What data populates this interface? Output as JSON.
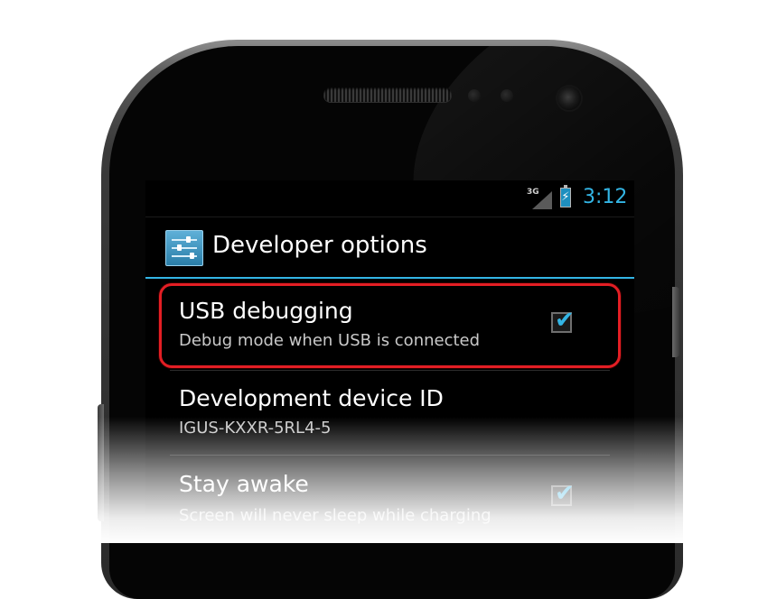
{
  "status_bar": {
    "network_label": "3G",
    "clock": "3:12",
    "icons": [
      "signal-icon",
      "battery-charging-icon"
    ]
  },
  "action_bar": {
    "title": "Developer options",
    "icon": "settings-sliders-icon"
  },
  "settings": [
    {
      "title": "USB debugging",
      "subtitle": "Debug mode when USB is connected",
      "checked": true,
      "highlighted": true
    },
    {
      "title": "Development device ID",
      "subtitle": "IGUS-KXXR-5RL4-5"
    },
    {
      "title": "Stay awake",
      "subtitle": "Screen will never sleep while charging",
      "checked": true
    }
  ],
  "colors": {
    "accent": "#33b5e5",
    "highlight": "#e31e24",
    "background": "#000000"
  }
}
